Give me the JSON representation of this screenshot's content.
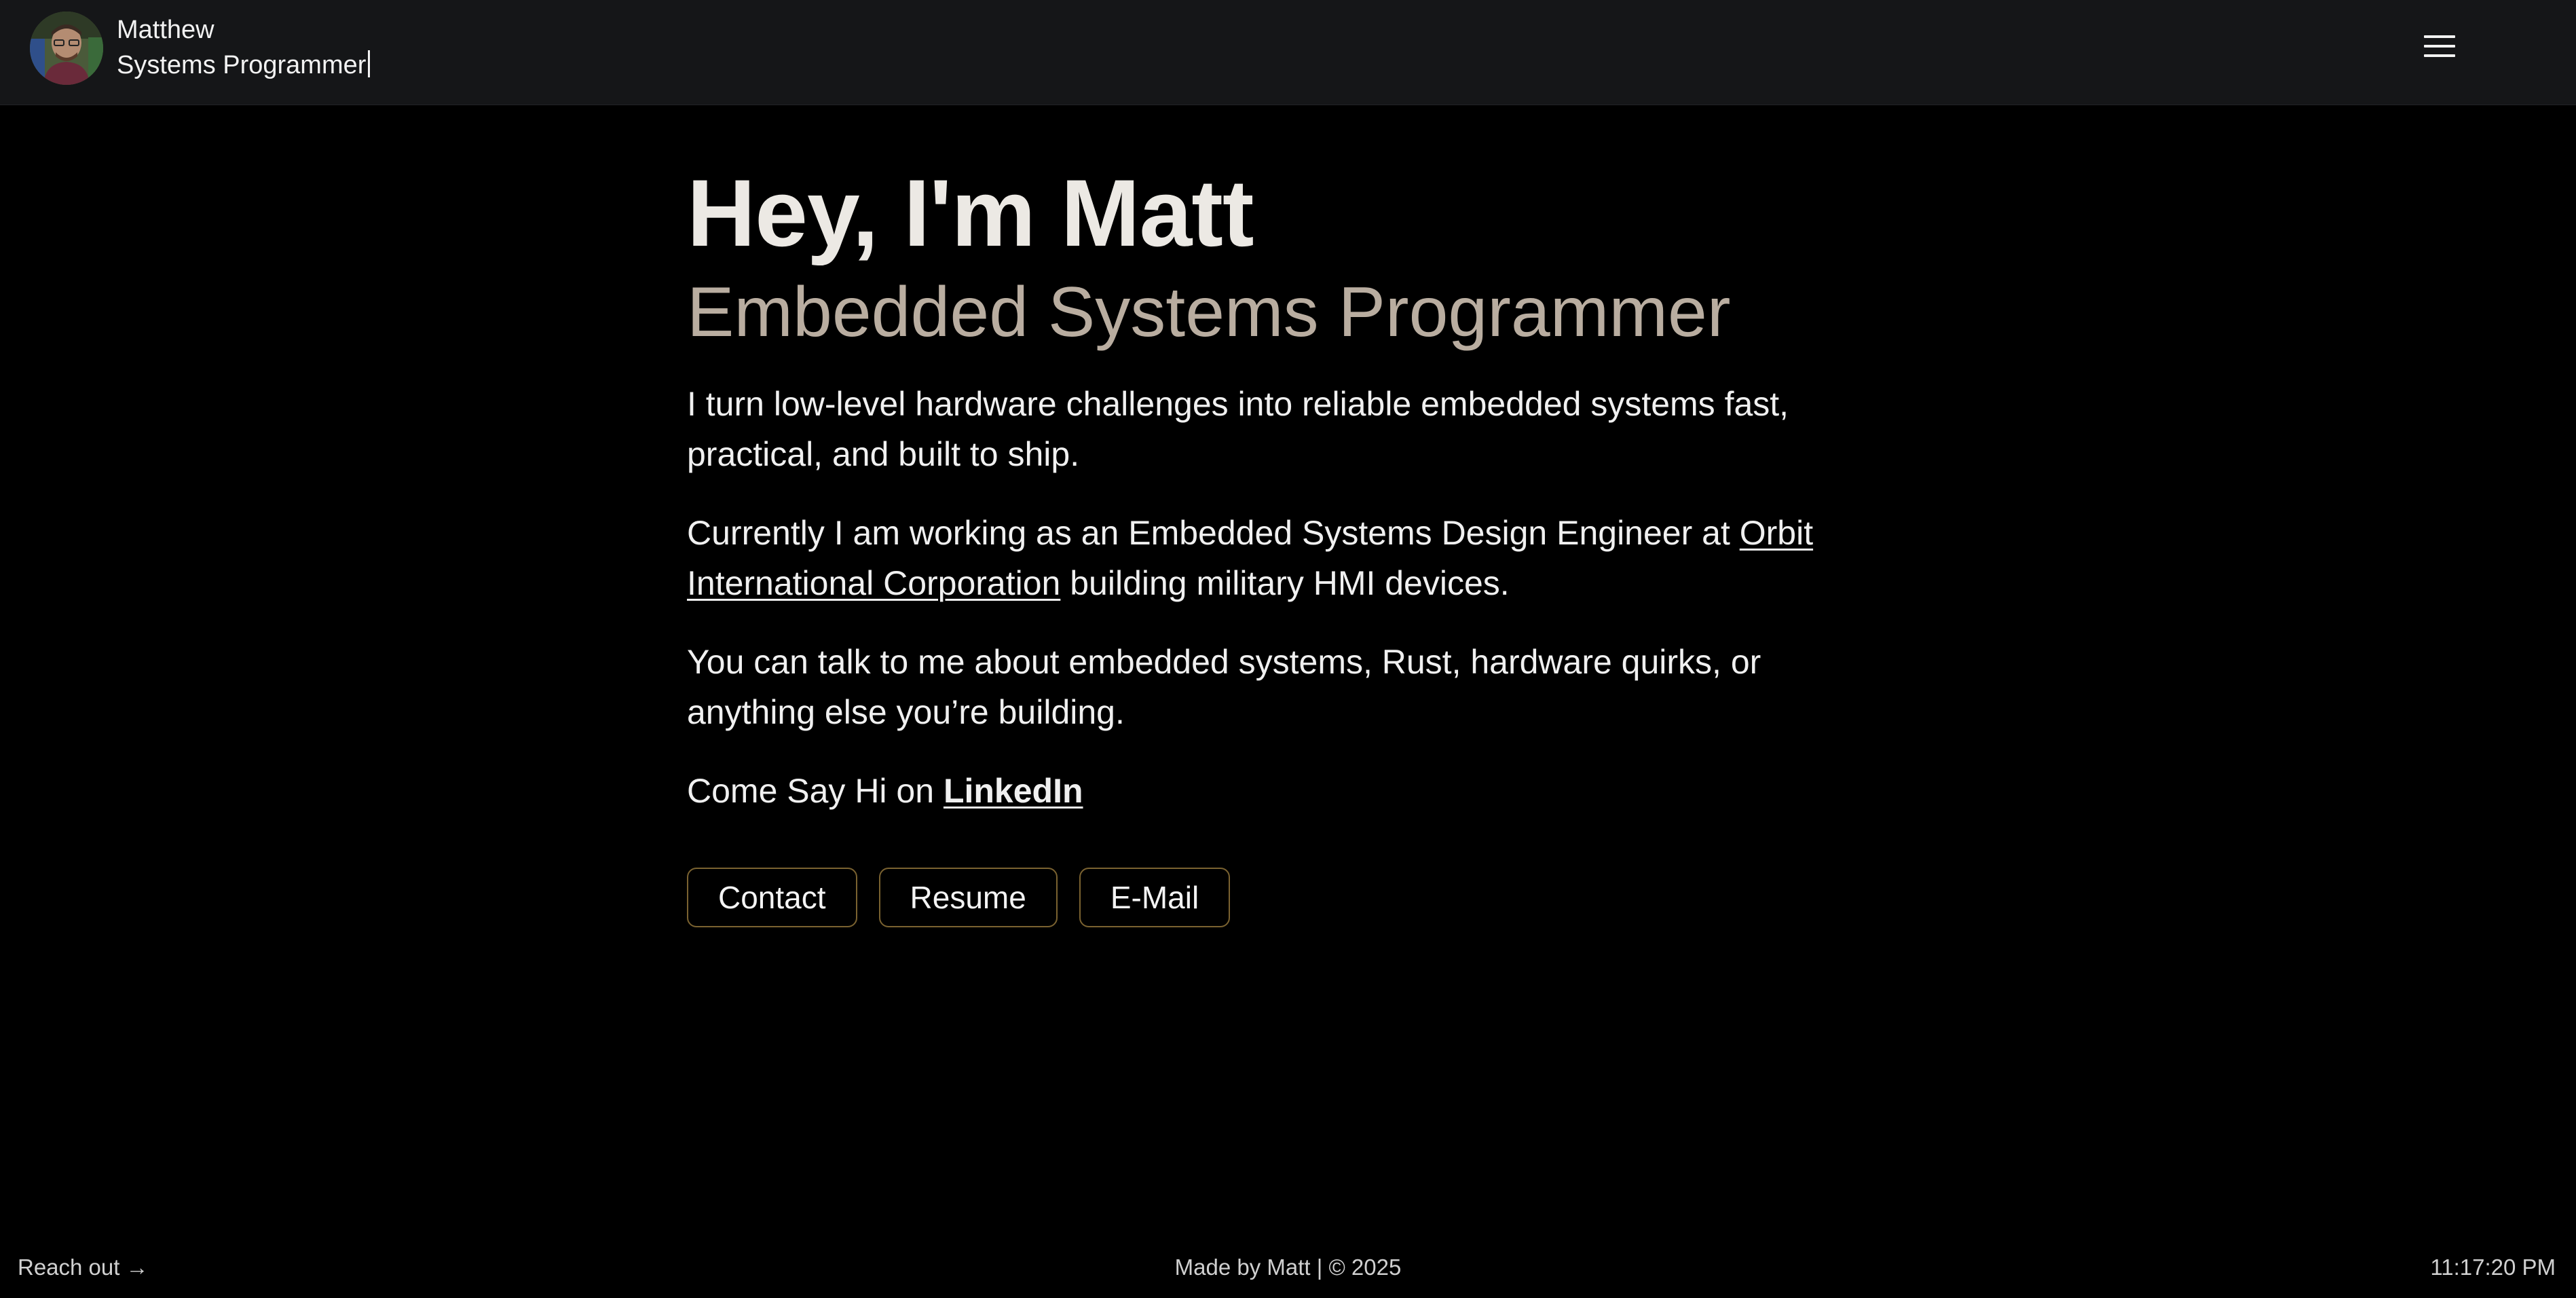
{
  "header": {
    "name": "Matthew",
    "role": "Systems Programmer"
  },
  "hero": {
    "title": "Hey, I'm Matt",
    "subtitle": "Embedded Systems Programmer"
  },
  "intro": {
    "p1": "I turn low-level hardware challenges into reliable embedded systems fast, practical, and built to ship.",
    "p2_prefix": "Currently I am working as an Embedded Systems Design Engineer at ",
    "p2_link": "Orbit International Corporation",
    "p2_suffix": " building military HMI devices.",
    "p3": "You can talk to me about embedded systems, Rust, hardware quirks, or anything else you’re building.",
    "p4_prefix": "Come Say Hi on ",
    "p4_link": "LinkedIn"
  },
  "actions": {
    "contact": "Contact",
    "resume": "Resume",
    "email": "E-Mail"
  },
  "footer": {
    "left": "Reach out →",
    "center": "Made by Matt | © 2025",
    "time": "11:17:20 PM"
  },
  "colors": {
    "background": "#000000",
    "header_bg": "#151618",
    "subtitle": "#b9ada0",
    "button_border": "#7a6230"
  },
  "icons": {
    "menu": "hamburger-menu-icon"
  }
}
